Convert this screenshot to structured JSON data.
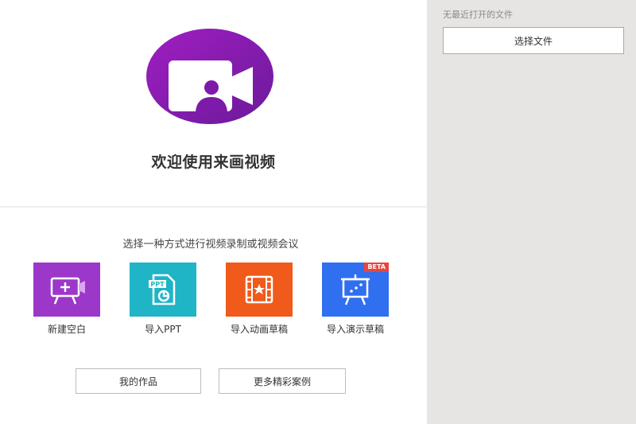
{
  "welcome": {
    "title": "欢迎使用来画视频"
  },
  "main": {
    "subtitle": "选择一种方式进行视频录制或视频会议",
    "options": [
      {
        "label": "新建空白",
        "icon": "new-blank-icon",
        "color": "#9b38c9"
      },
      {
        "label": "导入PPT",
        "icon": "ppt-import-icon",
        "color": "#1fb4c6"
      },
      {
        "label": "导入动画草稿",
        "icon": "animation-draft-icon",
        "color": "#f05a1a"
      },
      {
        "label": "导入演示草稿",
        "icon": "presentation-draft-icon",
        "color": "#2f6ff0",
        "badge": "BETA"
      }
    ],
    "buttons": {
      "my_works": "我的作品",
      "more_examples": "更多精彩案例"
    }
  },
  "sidebar": {
    "empty_recent": "无最近打开的文件",
    "choose_file": "选择文件"
  },
  "colors": {
    "brand_purple": "#8b1fb5",
    "sidebar_bg": "#e6e5e3"
  }
}
